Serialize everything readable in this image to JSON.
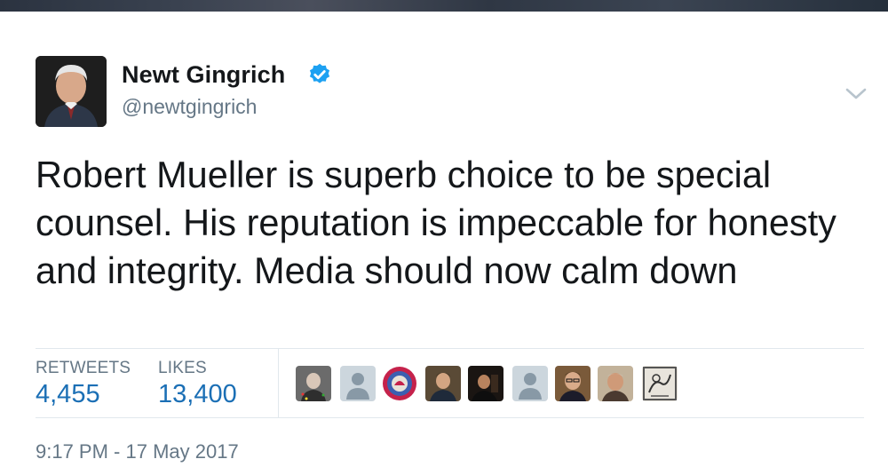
{
  "tweet": {
    "author_name": "Newt Gingrich",
    "author_handle": "@newtgingrich",
    "verified": true,
    "text": "Robert Mueller is superb choice to be special counsel. His reputation is impeccable for honesty and integrity. Media should now calm down",
    "retweets_label": "RETWEETS",
    "retweets_count": "4,455",
    "likes_label": "LIKES",
    "likes_count": "13,400",
    "timestamp": "9:17 PM - 17 May 2017"
  },
  "icons": {
    "verified": "verified-badge-icon",
    "more": "chevron-down-icon"
  },
  "colors": {
    "verified_blue": "#1da1f2",
    "count_blue": "#1b6fb5",
    "muted_gray": "#657786",
    "divider": "#e1e8ed"
  }
}
